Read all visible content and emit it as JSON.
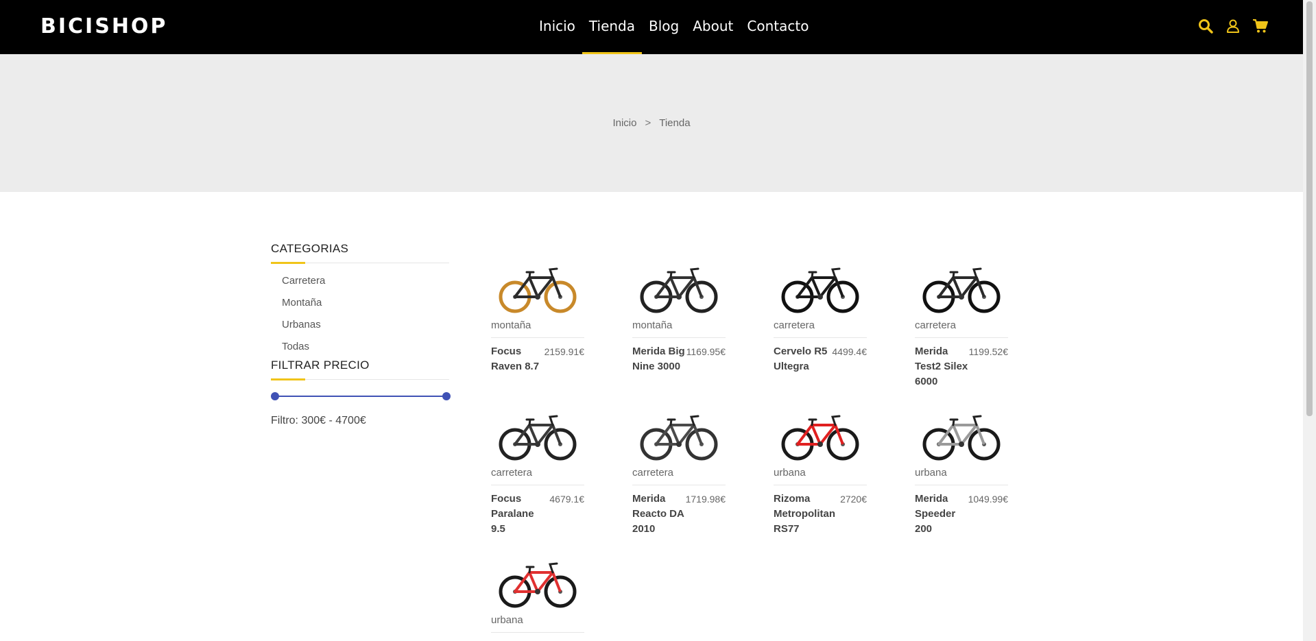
{
  "header": {
    "logo": "BICISHOP",
    "nav": [
      "Inicio",
      "Tienda",
      "Blog",
      "About",
      "Contacto"
    ],
    "active_nav": "Tienda",
    "icons": [
      "search-icon",
      "user-icon",
      "cart-icon"
    ],
    "accent_color": "#f0c419"
  },
  "breadcrumb": {
    "home": "Inicio",
    "separator": ">",
    "current": "Tienda"
  },
  "sidebar": {
    "categories_title": "CATEGORIAS",
    "categories": [
      "Carretera",
      "Montaña",
      "Urbanas",
      "Todas"
    ],
    "price_title": "FILTRAR PRECIO",
    "filter_text": "Filtro: 300€ - 4700€",
    "slider_color": "#3f51b5"
  },
  "products": [
    {
      "category": "montaña",
      "name": "Focus Raven 8.7",
      "price": "2159.91€",
      "frame_color": "#2b2b2b",
      "wheel_color": "#c8892a"
    },
    {
      "category": "montaña",
      "name": "Merida Big Nine 3000",
      "price": "1169.95€",
      "frame_color": "#333333",
      "wheel_color": "#222222"
    },
    {
      "category": "carretera",
      "name": "Cervelo R5 Ultegra",
      "price": "4499.4€",
      "frame_color": "#1a1a1a",
      "wheel_color": "#111111"
    },
    {
      "category": "carretera",
      "name": "Merida Test2 Silex 6000",
      "price": "1199.52€",
      "frame_color": "#2a2a2a",
      "wheel_color": "#111111"
    },
    {
      "category": "carretera",
      "name": "Focus Paralane 9.5",
      "price": "4679.1€",
      "frame_color": "#3a3a3a",
      "wheel_color": "#222222"
    },
    {
      "category": "carretera",
      "name": "Merida Reacto DA 2010",
      "price": "1719.98€",
      "frame_color": "#4a4a4a",
      "wheel_color": "#333333"
    },
    {
      "category": "urbana",
      "name": "Rizoma Metropolitan RS77",
      "price": "2720€",
      "frame_color": "#e02020",
      "wheel_color": "#1a1a1a"
    },
    {
      "category": "urbana",
      "name": "Merida Speeder 200",
      "price": "1049.99€",
      "frame_color": "#e8e8e8",
      "wheel_color": "#1a1a1a"
    },
    {
      "category": "urbana",
      "name": "",
      "price": "",
      "frame_color": "#e03030",
      "wheel_color": "#1a1a1a"
    }
  ]
}
